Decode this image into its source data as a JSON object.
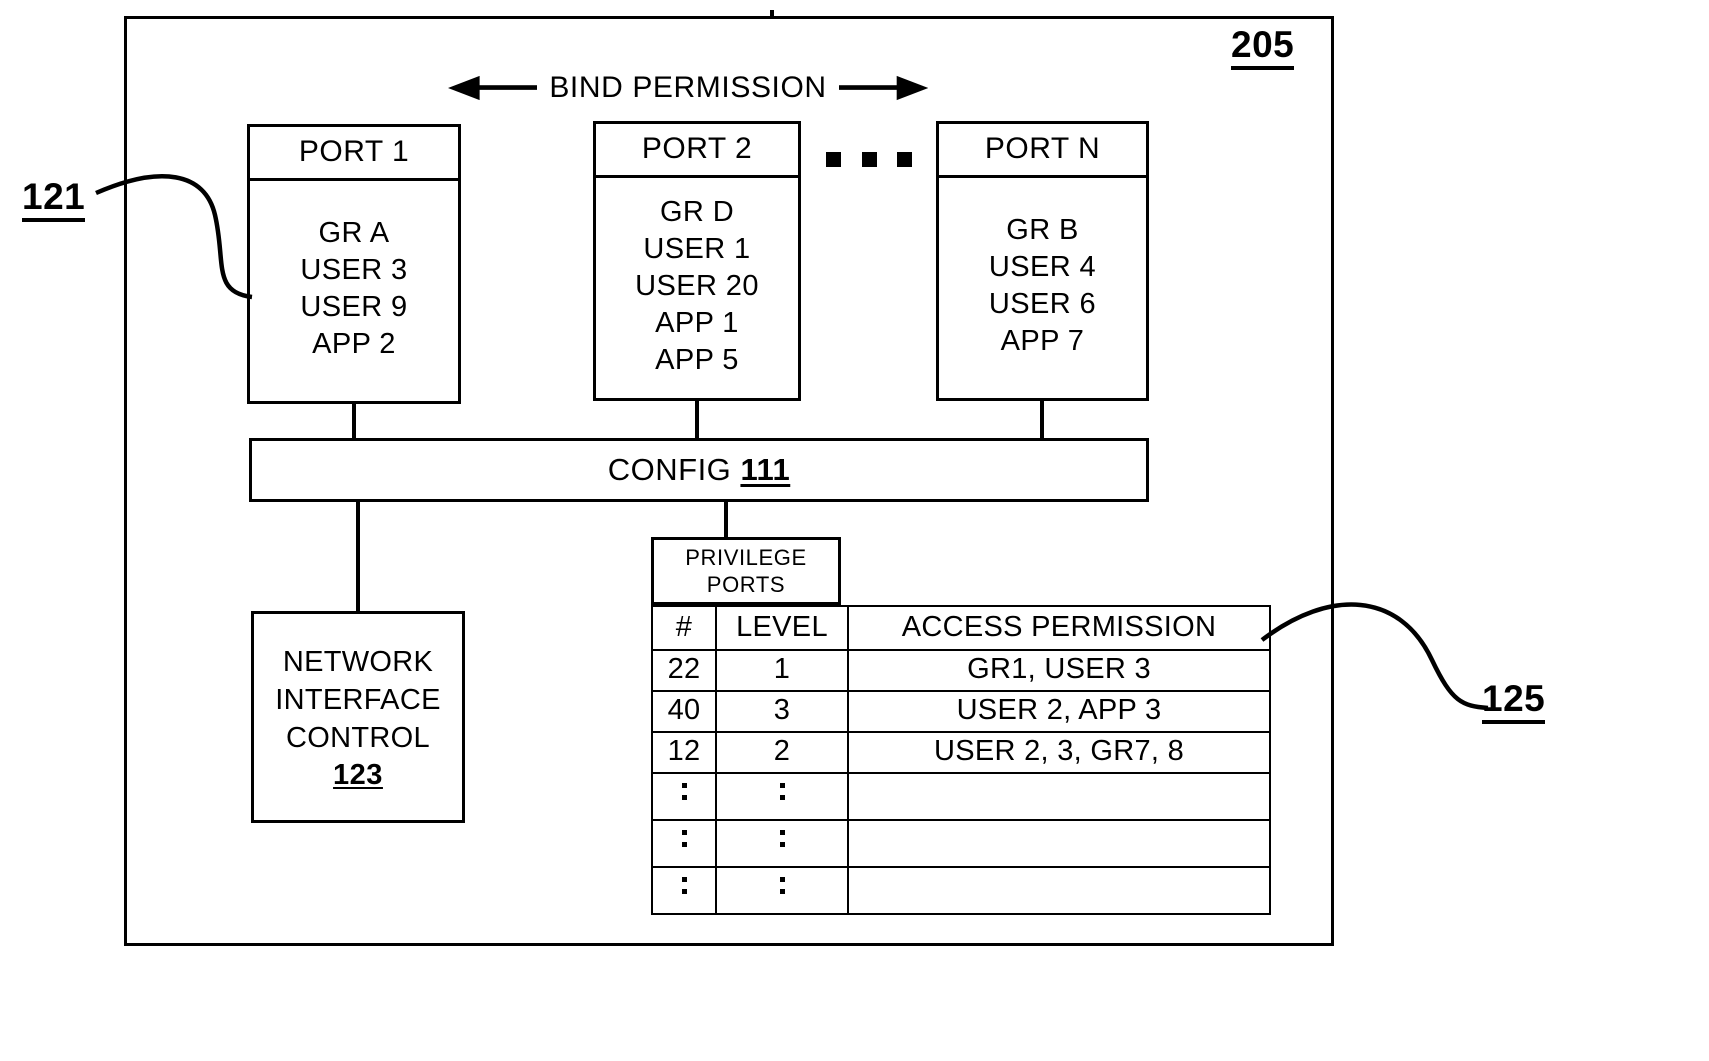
{
  "figure": {
    "system_ref": "205",
    "ports_group_ref": "121",
    "privilege_table_ref": "125"
  },
  "bind": {
    "label": "BIND PERMISSION",
    "left_arrow_icon": "arrow-left-icon",
    "right_arrow_icon": "arrow-right-icon"
  },
  "ports": [
    {
      "title": "PORT 1",
      "entries": [
        "GR A",
        "USER 3",
        "USER 9",
        "APP 2"
      ]
    },
    {
      "title": "PORT 2",
      "entries": [
        "GR D",
        "USER 1",
        "USER 20",
        "APP 1",
        "APP 5"
      ]
    },
    {
      "title": "PORT N",
      "entries": [
        "GR B",
        "USER 4",
        "USER 6",
        "APP 7"
      ]
    }
  ],
  "ports_ellipsis": "• • •",
  "config": {
    "label": "CONFIG",
    "ref": "111"
  },
  "network_interface": {
    "line1": "NETWORK",
    "line2": "INTERFACE",
    "line3": "CONTROL",
    "ref": "123"
  },
  "privilege_ports": {
    "title_line1": "PRIVILEGE",
    "title_line2": "PORTS",
    "columns": [
      "#",
      "LEVEL",
      "ACCESS PERMISSION"
    ],
    "rows": [
      {
        "num": "22",
        "level": "1",
        "permission": "GR1, USER 3"
      },
      {
        "num": "40",
        "level": "3",
        "permission": "USER 2, APP 3"
      },
      {
        "num": "12",
        "level": "2",
        "permission": "USER 2, 3, GR7, 8"
      }
    ],
    "continuation_rows": 3,
    "continuation_glyph": "⋮"
  },
  "colors": {
    "ink": "#000000",
    "paper": "#ffffff"
  }
}
